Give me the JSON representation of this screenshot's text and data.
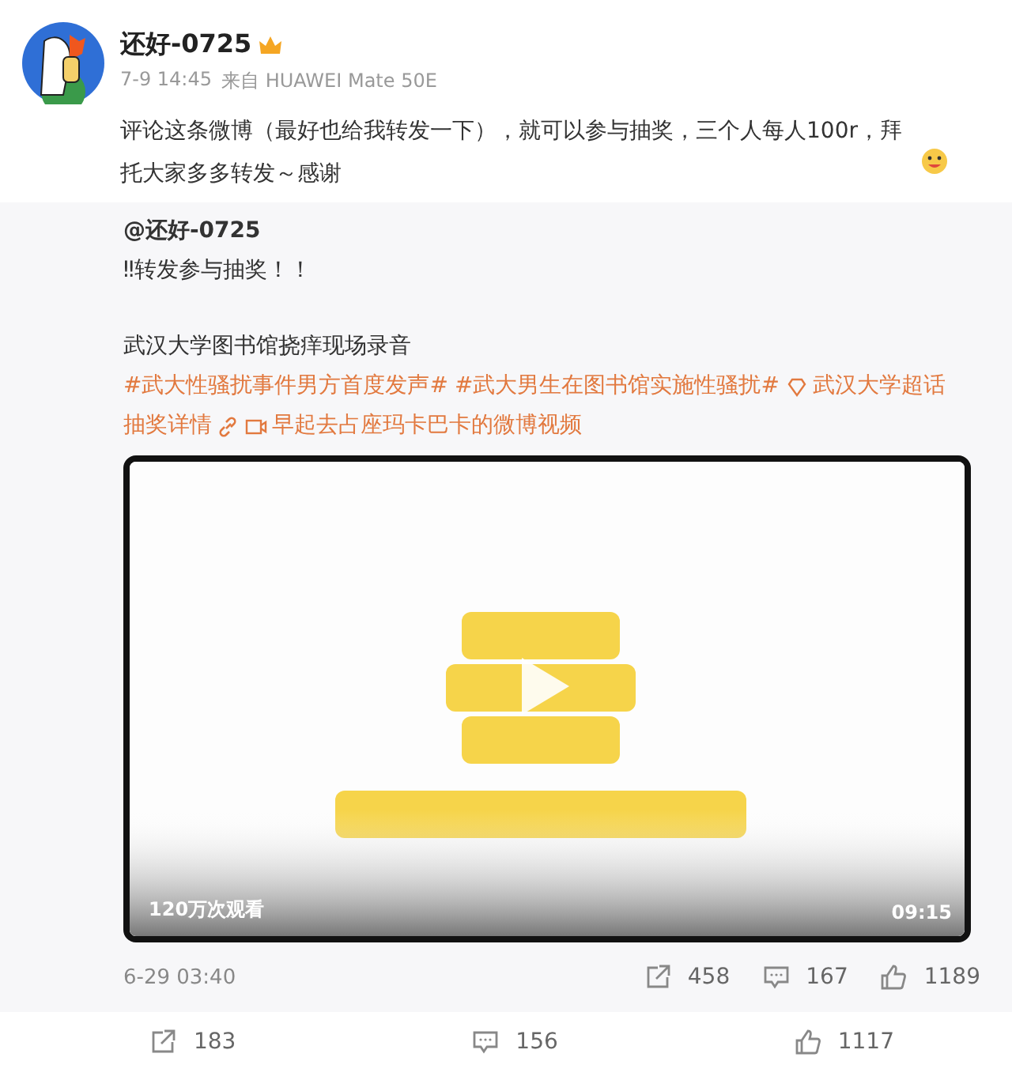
{
  "post": {
    "author": "还好-0725",
    "time": "7-9 14:45",
    "source": "来自 HUAWEI Mate 50E",
    "text": "评论这条微博（最好也给我转发一下），就可以参与抽奖，三个人每人100r，拜托大家多多转发～感谢"
  },
  "repost": {
    "author": "@还好-0725",
    "intro": "‼转发参与抽奖！！",
    "title": "武汉大学图书馆挠痒现场录音",
    "links": [
      {
        "kind": "topic",
        "text": "#武大性骚扰事件男方首度发声#"
      },
      {
        "kind": "topic",
        "text": "#武大男生在图书馆实施性骚扰#"
      },
      {
        "kind": "super",
        "text": "武汉大学超话"
      },
      {
        "kind": "chain",
        "text": "抽奖详情"
      },
      {
        "kind": "video",
        "text": "早起去占座玛卡巴卡的微博视频"
      }
    ],
    "video": {
      "kind": "picture",
      "views": "120万次观看",
      "duration": "09:15"
    },
    "time": "6-29 03:40",
    "reposts": "458",
    "comments": "167",
    "likes": "1189"
  },
  "actions": {
    "reposts": "183",
    "comments": "156",
    "likes": "1117"
  }
}
